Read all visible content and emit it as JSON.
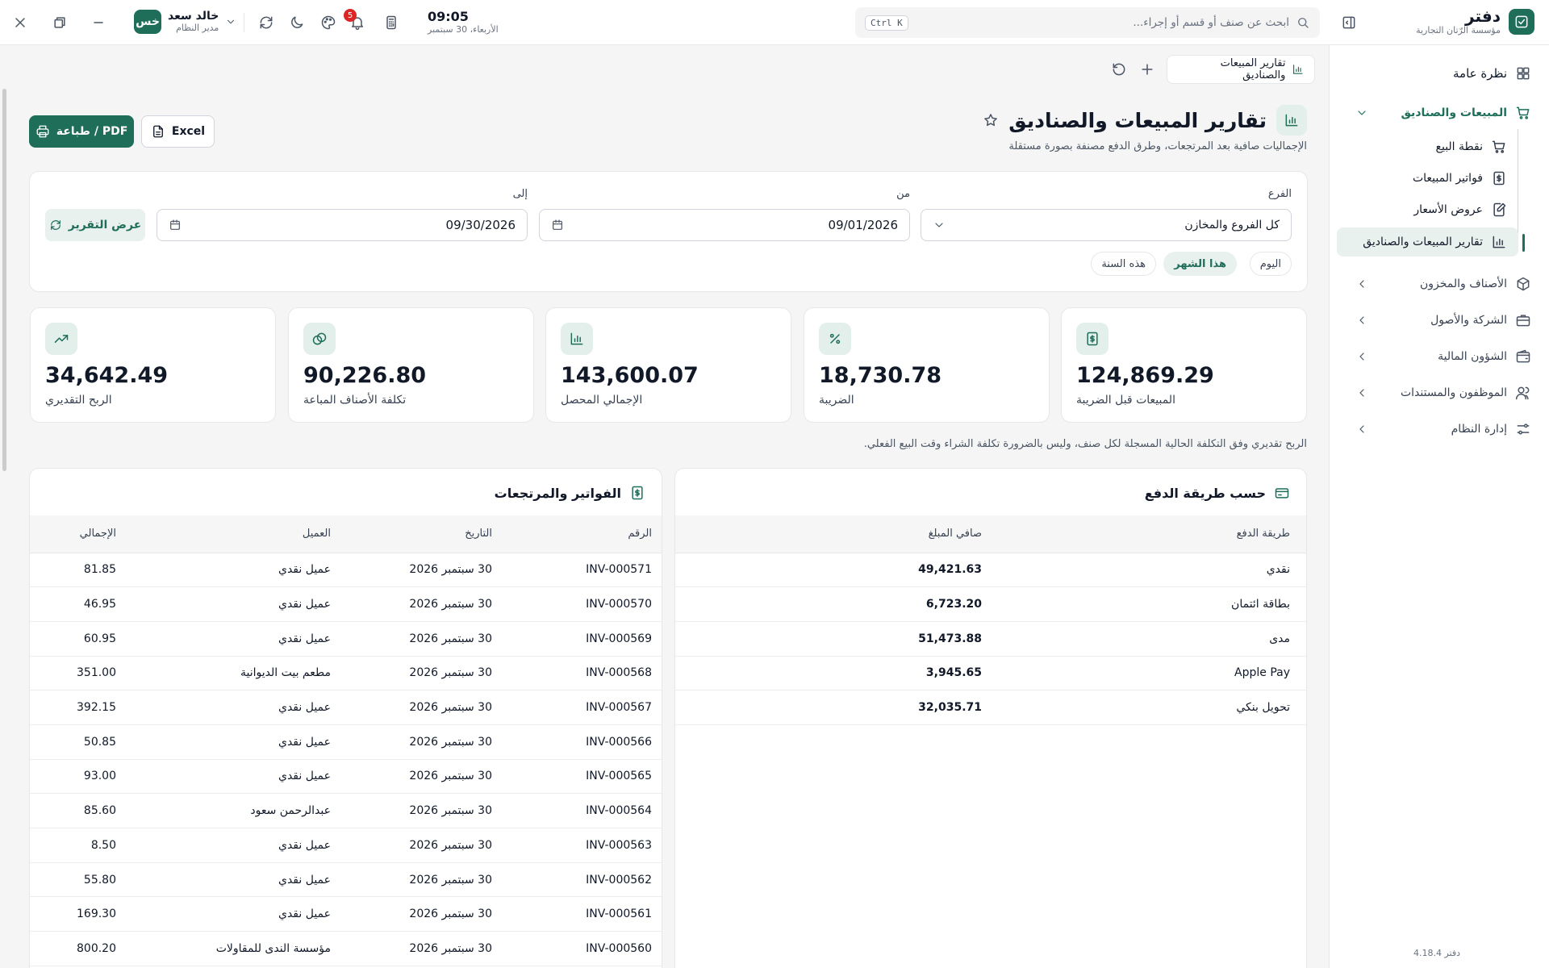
{
  "app": {
    "name": "دفتر",
    "company": "مؤسسة الرّتان التجارية",
    "version": "دفتر 4.18.4"
  },
  "topbar": {
    "search_placeholder": "ابحث عن صنف أو قسم أو إجراء...",
    "search_shortcut": "Ctrl K",
    "time": "09:05",
    "date": "الأربعاء، 30 سبتمبر",
    "notifications_count": "5",
    "user": {
      "initials": "خس",
      "name": "خالد سعد",
      "role": "مدير النظام"
    }
  },
  "sidebar": {
    "overview": "نظرة عامة",
    "sales_group": "المبيعات والصناديق",
    "sales_items": [
      {
        "label": "نقطة البيع",
        "icon": "cart-icon"
      },
      {
        "label": "فواتير المبيعات",
        "icon": "invoice-icon"
      },
      {
        "label": "عروض الأسعار",
        "icon": "quote-icon"
      },
      {
        "label": "تقارير المبيعات والصناديق",
        "icon": "chart-icon",
        "active": true
      }
    ],
    "groups": [
      {
        "label": "الأصناف والمخزون",
        "icon": "box-icon"
      },
      {
        "label": "الشركة والأصول",
        "icon": "briefcase-icon"
      },
      {
        "label": "الشؤون المالية",
        "icon": "wallet-icon"
      },
      {
        "label": "الموظفون والمستندات",
        "icon": "users-icon"
      },
      {
        "label": "إدارة النظام",
        "icon": "settings-icon"
      }
    ]
  },
  "tab": {
    "label": "تقارير المبيعات والصناديق"
  },
  "page": {
    "title": "تقارير المبيعات والصناديق",
    "subtitle": "الإجماليات صافية بعد المرتجعات، وطرق الدفع مصنفة بصورة مستقلة",
    "print_label": "PDF / طباعة",
    "excel_label": "Excel"
  },
  "filters": {
    "branch_label": "الفرع",
    "branch_value": "كل الفروع والمخازن",
    "from_label": "من",
    "from_value": "09/01/2026",
    "to_label": "إلى",
    "to_value": "09/30/2026",
    "show_label": "عرض التقرير",
    "chips": [
      "اليوم",
      "هذا الشهر",
      "هذه السنة"
    ],
    "active_chip": "هذا الشهر"
  },
  "kpis": [
    {
      "value": "124,869.29",
      "label": "المبيعات قبل الضريبة",
      "icon": "dollar-doc-icon"
    },
    {
      "value": "18,730.78",
      "label": "الضريبة",
      "icon": "percent-icon"
    },
    {
      "value": "143,600.07",
      "label": "الإجمالي المحصل",
      "icon": "bar-chart-icon"
    },
    {
      "value": "90,226.80",
      "label": "تكلفة الأصناف المباعة",
      "icon": "coins-icon"
    },
    {
      "value": "34,642.49",
      "label": "الربح التقديري",
      "icon": "trending-up-icon"
    }
  ],
  "note": "الربح تقديري وفق التكلفة الحالية المسجلة لكل صنف، وليس بالضرورة تكلفة الشراء وقت البيع الفعلي.",
  "payments": {
    "title": "حسب طريقة الدفع",
    "columns": [
      "طريقة الدفع",
      "صافي المبلغ"
    ],
    "rows": [
      [
        "نقدي",
        "49,421.63"
      ],
      [
        "بطاقة ائتمان",
        "6,723.20"
      ],
      [
        "مدى",
        "51,473.88"
      ],
      [
        "Apple Pay",
        "3,945.65"
      ],
      [
        "تحويل بنكي",
        "32,035.71"
      ]
    ]
  },
  "invoices": {
    "title": "الفواتير والمرتجعات",
    "columns": [
      "الرقم",
      "التاريخ",
      "العميل",
      "الإجمالي"
    ],
    "rows": [
      [
        "INV-000571",
        "30 سبتمبر 2026",
        "عميل نقدي",
        "81.85"
      ],
      [
        "INV-000570",
        "30 سبتمبر 2026",
        "عميل نقدي",
        "46.95"
      ],
      [
        "INV-000569",
        "30 سبتمبر 2026",
        "عميل نقدي",
        "60.95"
      ],
      [
        "INV-000568",
        "30 سبتمبر 2026",
        "مطعم بيت الديوانية",
        "351.00"
      ],
      [
        "INV-000567",
        "30 سبتمبر 2026",
        "عميل نقدي",
        "392.15"
      ],
      [
        "INV-000566",
        "30 سبتمبر 2026",
        "عميل نقدي",
        "50.85"
      ],
      [
        "INV-000565",
        "30 سبتمبر 2026",
        "عميل نقدي",
        "93.00"
      ],
      [
        "INV-000564",
        "30 سبتمبر 2026",
        "عبدالرحمن سعود",
        "85.60"
      ],
      [
        "INV-000563",
        "30 سبتمبر 2026",
        "عميل نقدي",
        "8.50"
      ],
      [
        "INV-000562",
        "30 سبتمبر 2026",
        "عميل نقدي",
        "55.80"
      ],
      [
        "INV-000561",
        "30 سبتمبر 2026",
        "عميل نقدي",
        "169.30"
      ],
      [
        "INV-000560",
        "30 سبتمبر 2026",
        "مؤسسة الندى للمقاولات",
        "800.20"
      ]
    ]
  },
  "colors": {
    "accent": "#1f6e5a",
    "accent_soft": "#e8f1ee",
    "danger": "#dc2626"
  }
}
